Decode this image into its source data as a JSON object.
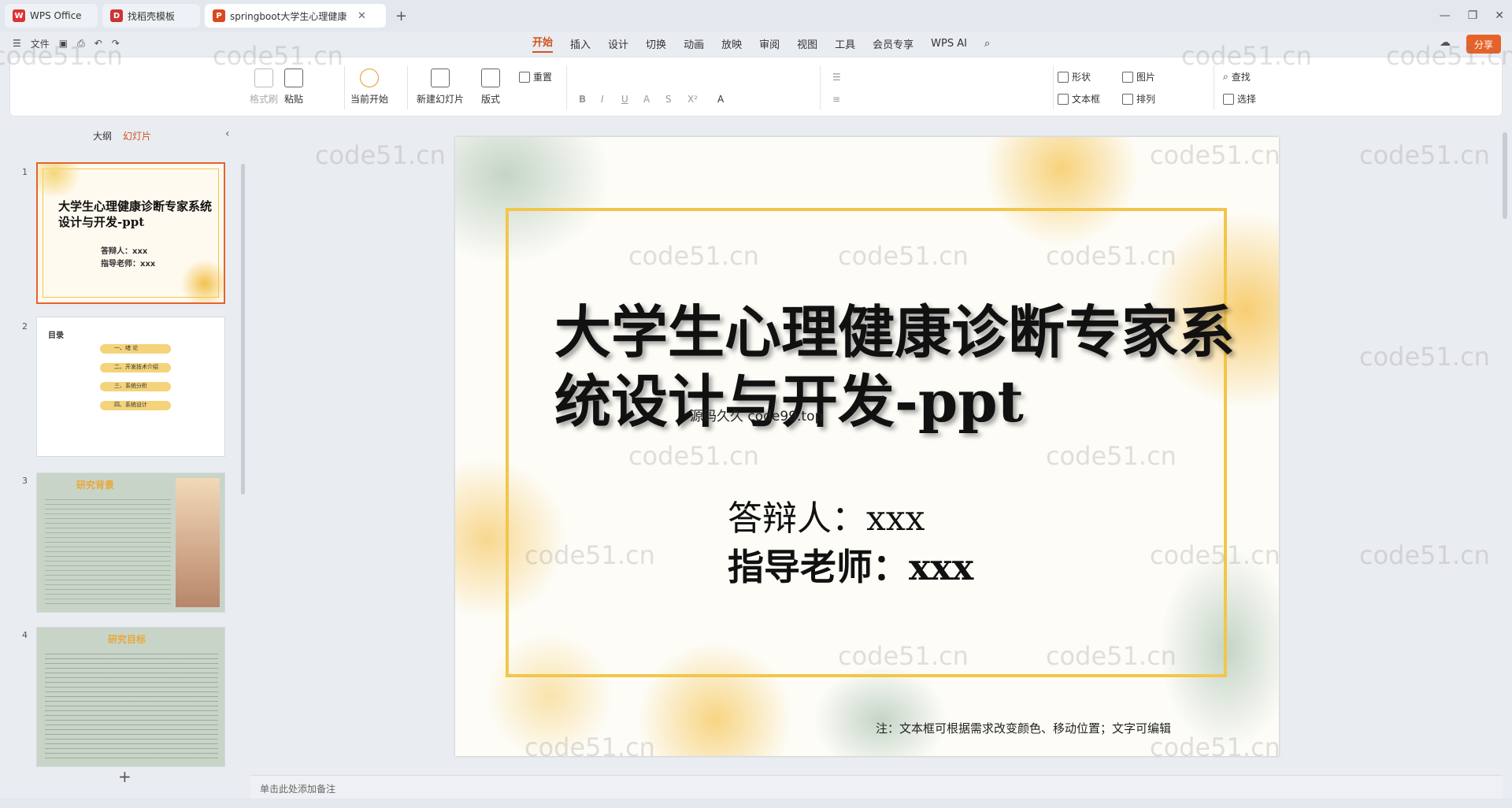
{
  "tabs": [
    {
      "label": "WPS Office",
      "logo": "W"
    },
    {
      "label": "找稻壳模板",
      "logo": "D"
    },
    {
      "label": "springboot大学生心理健康",
      "logo": "P"
    }
  ],
  "menubar": {
    "file": "文件",
    "tabs": [
      "开始",
      "插入",
      "设计",
      "切换",
      "动画",
      "放映",
      "审阅",
      "视图",
      "工具",
      "会员专享",
      "WPS AI"
    ],
    "share": "分享"
  },
  "ribbon": {
    "format_painter": "格式刷",
    "paste": "粘贴",
    "start_from_current": "当前开始",
    "new_slide": "新建幻灯片",
    "layout": "版式",
    "reset": "重置",
    "shape": "形状",
    "picture": "图片",
    "textbox": "文本框",
    "arrange": "排列",
    "find": "查找",
    "select": "选择"
  },
  "left_panel": {
    "outline_tab": "大纲",
    "slides_tab": "幻灯片",
    "slides": [
      {
        "num": "1",
        "title": "大学生心理健康诊断专家系统设计与开发-ppt",
        "l1": "答辩人：xxx",
        "l2": "指导老师：xxx"
      },
      {
        "num": "2",
        "title": "目录",
        "items": [
          "一、绪  论",
          "二、开发技术介绍",
          "三、系统分析",
          "四、系统设计"
        ]
      },
      {
        "num": "3",
        "title": "研究背景"
      },
      {
        "num": "4",
        "title": "研究目标"
      }
    ]
  },
  "slide": {
    "title": "大学生心理健康诊断专家系统设计与开发-ppt",
    "subtitle": "源码久久 code99.top",
    "presenter": "答辩人：xxx",
    "advisor": "指导老师：xxx",
    "note": "注：文本框可根据需求改变颜色、移动位置；文字可编辑"
  },
  "notes_placeholder": "单击此处添加备注",
  "watermark": "code51.cn",
  "colors": {
    "accent": "#e5632b",
    "frame": "#f2c64a"
  }
}
